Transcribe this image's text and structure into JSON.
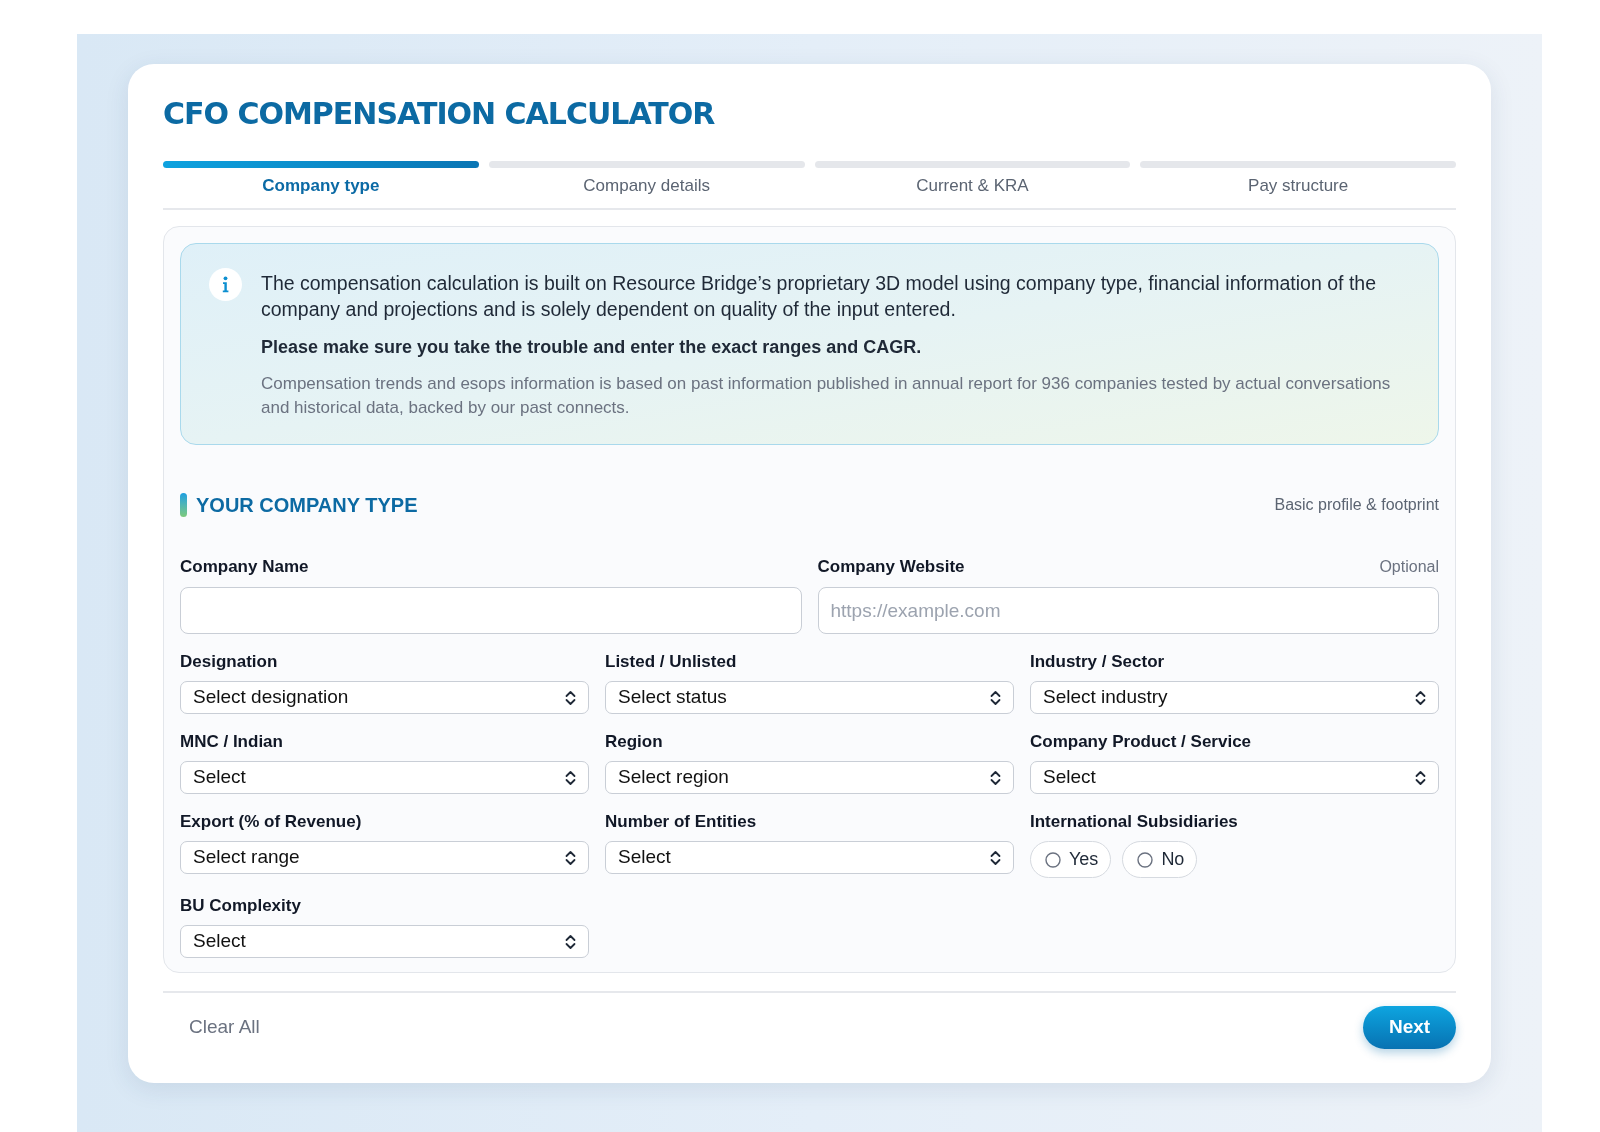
{
  "page": {
    "title": "CFO COMPENSATION CALCULATOR"
  },
  "steps": [
    {
      "label": "Company type",
      "selected": true
    },
    {
      "label": "Company details",
      "selected": false
    },
    {
      "label": "Current & KRA",
      "selected": false
    },
    {
      "label": "Pay structure",
      "selected": false
    }
  ],
  "notice": {
    "body": "The compensation calculation is built on Resource Bridge’s proprietary 3D model using company type, financial information of the company and projections and is solely dependent on quality of the input entered.",
    "emphasis": "Please make sure you take the trouble and enter the exact ranges and CAGR.",
    "note": "Compensation trends and esops information is based on past information published in annual report for 936 companies tested by actual conversations and historical data, backed by our past connects."
  },
  "section": {
    "title": "YOUR COMPANY TYPE",
    "subtitle": "Basic profile & footprint"
  },
  "text_fields": [
    {
      "label": "Company Name"
    },
    {
      "label": "Company Website",
      "hint": "Optional",
      "placeholder": "https://example.com"
    }
  ],
  "fields": [
    {
      "kind": "select",
      "label": "Designation",
      "value": "Select designation"
    },
    {
      "kind": "select",
      "label": "Listed / Unlisted",
      "value": "Select status"
    },
    {
      "kind": "select",
      "label": "Industry / Sector",
      "value": "Select industry"
    },
    {
      "kind": "select",
      "label": "MNC / Indian",
      "value": "Select"
    },
    {
      "kind": "select",
      "label": "Region",
      "value": "Select region"
    },
    {
      "kind": "select",
      "label": "Company Product / Service",
      "value": "Select"
    },
    {
      "kind": "select",
      "label": "Export (% of Revenue)",
      "value": "Select range"
    },
    {
      "kind": "select",
      "label": "Number of Entities",
      "value": "Select"
    },
    {
      "kind": "radio",
      "label": "International Subsidiaries",
      "options": [
        {
          "label": "Yes",
          "selected": false
        },
        {
          "label": "No",
          "selected": false
        }
      ]
    },
    {
      "kind": "select",
      "label": "BU Complexity",
      "value": "Select"
    }
  ],
  "footer": {
    "clear": "Clear All",
    "next": "Next"
  }
}
